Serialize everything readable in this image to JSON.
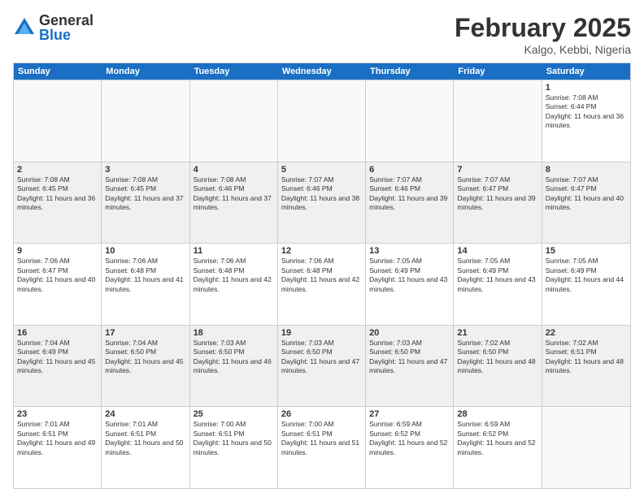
{
  "header": {
    "logo_general": "General",
    "logo_blue": "Blue",
    "month_title": "February 2025",
    "location": "Kalgo, Kebbi, Nigeria"
  },
  "calendar": {
    "days_of_week": [
      "Sunday",
      "Monday",
      "Tuesday",
      "Wednesday",
      "Thursday",
      "Friday",
      "Saturday"
    ],
    "weeks": [
      [
        {
          "day": "",
          "info": "",
          "empty": true
        },
        {
          "day": "",
          "info": "",
          "empty": true
        },
        {
          "day": "",
          "info": "",
          "empty": true
        },
        {
          "day": "",
          "info": "",
          "empty": true
        },
        {
          "day": "",
          "info": "",
          "empty": true
        },
        {
          "day": "",
          "info": "",
          "empty": true
        },
        {
          "day": "1",
          "info": "Sunrise: 7:08 AM\nSunset: 6:44 PM\nDaylight: 11 hours and 36 minutes.",
          "empty": false
        }
      ],
      [
        {
          "day": "2",
          "info": "Sunrise: 7:08 AM\nSunset: 6:45 PM\nDaylight: 11 hours and 36 minutes.",
          "empty": false,
          "shaded": true
        },
        {
          "day": "3",
          "info": "Sunrise: 7:08 AM\nSunset: 6:45 PM\nDaylight: 11 hours and 37 minutes.",
          "empty": false,
          "shaded": true
        },
        {
          "day": "4",
          "info": "Sunrise: 7:08 AM\nSunset: 6:46 PM\nDaylight: 11 hours and 37 minutes.",
          "empty": false,
          "shaded": true
        },
        {
          "day": "5",
          "info": "Sunrise: 7:07 AM\nSunset: 6:46 PM\nDaylight: 11 hours and 38 minutes.",
          "empty": false,
          "shaded": true
        },
        {
          "day": "6",
          "info": "Sunrise: 7:07 AM\nSunset: 6:46 PM\nDaylight: 11 hours and 39 minutes.",
          "empty": false,
          "shaded": true
        },
        {
          "day": "7",
          "info": "Sunrise: 7:07 AM\nSunset: 6:47 PM\nDaylight: 11 hours and 39 minutes.",
          "empty": false,
          "shaded": true
        },
        {
          "day": "8",
          "info": "Sunrise: 7:07 AM\nSunset: 6:47 PM\nDaylight: 11 hours and 40 minutes.",
          "empty": false,
          "shaded": true
        }
      ],
      [
        {
          "day": "9",
          "info": "Sunrise: 7:06 AM\nSunset: 6:47 PM\nDaylight: 11 hours and 40 minutes.",
          "empty": false
        },
        {
          "day": "10",
          "info": "Sunrise: 7:06 AM\nSunset: 6:48 PM\nDaylight: 11 hours and 41 minutes.",
          "empty": false
        },
        {
          "day": "11",
          "info": "Sunrise: 7:06 AM\nSunset: 6:48 PM\nDaylight: 11 hours and 42 minutes.",
          "empty": false
        },
        {
          "day": "12",
          "info": "Sunrise: 7:06 AM\nSunset: 6:48 PM\nDaylight: 11 hours and 42 minutes.",
          "empty": false
        },
        {
          "day": "13",
          "info": "Sunrise: 7:05 AM\nSunset: 6:49 PM\nDaylight: 11 hours and 43 minutes.",
          "empty": false
        },
        {
          "day": "14",
          "info": "Sunrise: 7:05 AM\nSunset: 6:49 PM\nDaylight: 11 hours and 43 minutes.",
          "empty": false
        },
        {
          "day": "15",
          "info": "Sunrise: 7:05 AM\nSunset: 6:49 PM\nDaylight: 11 hours and 44 minutes.",
          "empty": false
        }
      ],
      [
        {
          "day": "16",
          "info": "Sunrise: 7:04 AM\nSunset: 6:49 PM\nDaylight: 11 hours and 45 minutes.",
          "empty": false,
          "shaded": true
        },
        {
          "day": "17",
          "info": "Sunrise: 7:04 AM\nSunset: 6:50 PM\nDaylight: 11 hours and 45 minutes.",
          "empty": false,
          "shaded": true
        },
        {
          "day": "18",
          "info": "Sunrise: 7:03 AM\nSunset: 6:50 PM\nDaylight: 11 hours and 46 minutes.",
          "empty": false,
          "shaded": true
        },
        {
          "day": "19",
          "info": "Sunrise: 7:03 AM\nSunset: 6:50 PM\nDaylight: 11 hours and 47 minutes.",
          "empty": false,
          "shaded": true
        },
        {
          "day": "20",
          "info": "Sunrise: 7:03 AM\nSunset: 6:50 PM\nDaylight: 11 hours and 47 minutes.",
          "empty": false,
          "shaded": true
        },
        {
          "day": "21",
          "info": "Sunrise: 7:02 AM\nSunset: 6:50 PM\nDaylight: 11 hours and 48 minutes.",
          "empty": false,
          "shaded": true
        },
        {
          "day": "22",
          "info": "Sunrise: 7:02 AM\nSunset: 6:51 PM\nDaylight: 11 hours and 48 minutes.",
          "empty": false,
          "shaded": true
        }
      ],
      [
        {
          "day": "23",
          "info": "Sunrise: 7:01 AM\nSunset: 6:51 PM\nDaylight: 11 hours and 49 minutes.",
          "empty": false
        },
        {
          "day": "24",
          "info": "Sunrise: 7:01 AM\nSunset: 6:51 PM\nDaylight: 11 hours and 50 minutes.",
          "empty": false
        },
        {
          "day": "25",
          "info": "Sunrise: 7:00 AM\nSunset: 6:51 PM\nDaylight: 11 hours and 50 minutes.",
          "empty": false
        },
        {
          "day": "26",
          "info": "Sunrise: 7:00 AM\nSunset: 6:51 PM\nDaylight: 11 hours and 51 minutes.",
          "empty": false
        },
        {
          "day": "27",
          "info": "Sunrise: 6:59 AM\nSunset: 6:52 PM\nDaylight: 11 hours and 52 minutes.",
          "empty": false
        },
        {
          "day": "28",
          "info": "Sunrise: 6:59 AM\nSunset: 6:52 PM\nDaylight: 11 hours and 52 minutes.",
          "empty": false
        },
        {
          "day": "",
          "info": "",
          "empty": true
        }
      ]
    ]
  }
}
